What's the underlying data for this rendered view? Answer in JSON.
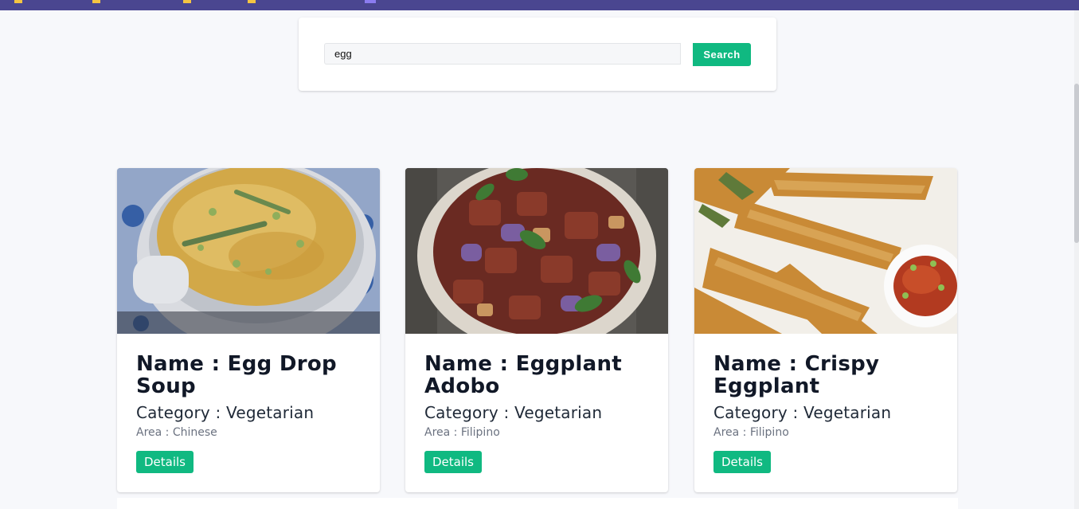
{
  "search": {
    "value": "egg",
    "button_label": "Search"
  },
  "meals": [
    {
      "name": "Name : Egg Drop Soup",
      "category": "Category : Vegetarian",
      "area": "Area : Chinese",
      "details_label": "Details"
    },
    {
      "name": "Name : Eggplant Adobo",
      "category": "Category : Vegetarian",
      "area": "Area : Filipino",
      "details_label": "Details"
    },
    {
      "name": "Name : Crispy Eggplant",
      "category": "Category : Vegetarian",
      "area": "Area : Filipino",
      "details_label": "Details"
    }
  ],
  "colors": {
    "topbar": "#4a4690",
    "accent": "#10b981",
    "background": "#f7f8fb"
  }
}
